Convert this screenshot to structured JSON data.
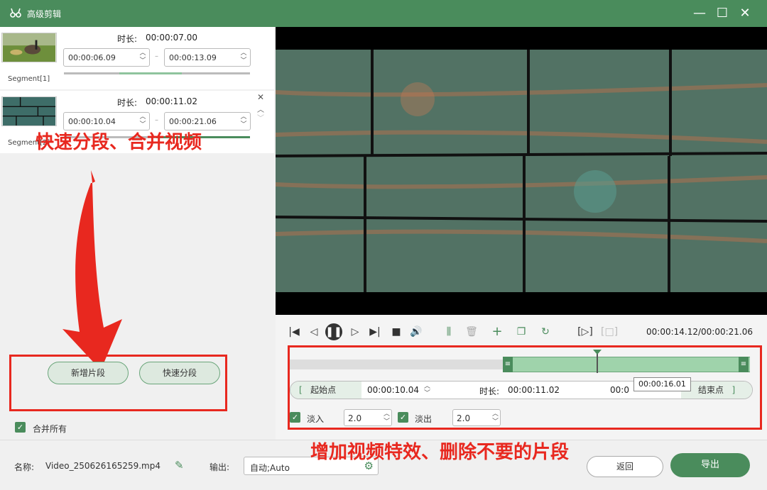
{
  "window": {
    "title": "高级剪辑"
  },
  "segments": [
    {
      "label": "Segment[1]",
      "duration_label": "时长:",
      "duration": "00:00:07.00",
      "start": "00:00:06.09",
      "end": "00:00:13.09",
      "sep": "–"
    },
    {
      "label": "Segment[2]",
      "duration_label": "时长:",
      "duration": "00:00:11.02",
      "start": "00:00:10.04",
      "end": "00:00:21.06",
      "sep": "–"
    }
  ],
  "annotations": {
    "top": "快速分段、合并视频",
    "bottom": "增加视频特效、删除不要的片段"
  },
  "left_buttons": {
    "add_segment": "新增片段",
    "quick_split": "快速分段",
    "merge_all": "合并所有"
  },
  "playback": {
    "time": "00:00:14.12/00:00:21.06"
  },
  "timeline": {
    "tooltip": "00:00:16.01",
    "start_label": "起始点",
    "start_value": "00:00:10.04",
    "duration_label": "时长:",
    "duration_value": "00:00:11.02",
    "end_value": "00:0",
    "end_label": "结束点",
    "fade_in_label": "淡入",
    "fade_in_value": "2.0",
    "fade_out_label": "淡出",
    "fade_out_value": "2.0"
  },
  "bottom": {
    "name_label": "名称:",
    "file_name": "Video_250626165259.mp4",
    "output_label": "输出:",
    "output_value": "自动;Auto",
    "back": "返回",
    "export": "导出"
  },
  "colors": {
    "accent": "#4a8c5c",
    "annotation": "#e8281f"
  }
}
